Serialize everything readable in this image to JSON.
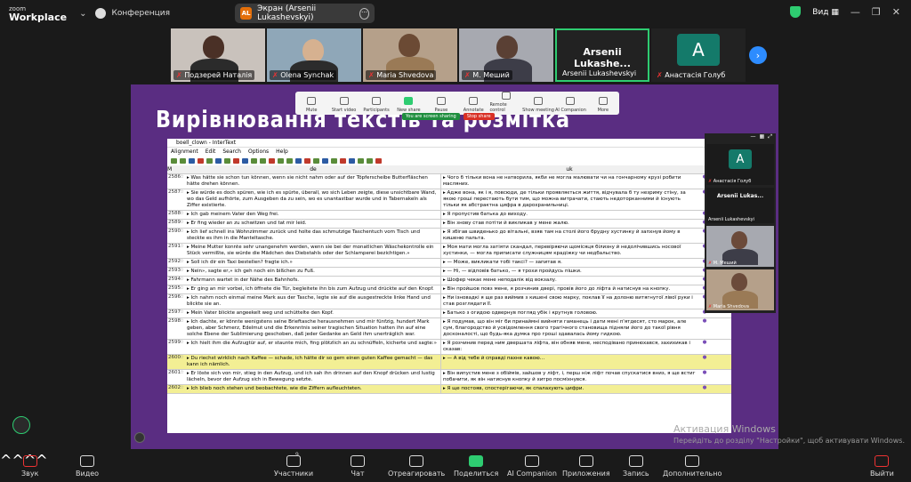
{
  "app": {
    "logo_top": "zoom",
    "logo_bottom": "Workplace",
    "conference_label": "Конференция"
  },
  "screen_share": {
    "badge": "AL",
    "label": "Экран (Arsenii Lukashevskyi)"
  },
  "top_right": {
    "view_label": "Вид"
  },
  "participants": [
    {
      "name": "Подзерей Наталія"
    },
    {
      "name": "Olena Synchak"
    },
    {
      "name": "Maria Shvedova"
    },
    {
      "name": "М. Меший"
    },
    {
      "name": "Arsenii Lukashevskyi",
      "big": "Arsenii Lukashe..."
    },
    {
      "name": "Анастасія Голуб",
      "initial": "A"
    }
  ],
  "share_toolbar": [
    "Mute",
    "Start video",
    "Participants",
    "New share",
    "Pause",
    "Annotate",
    "Remote control",
    "Show meeting",
    "AI Companion",
    "More"
  ],
  "share_status": {
    "sharing": "You are screen sharing",
    "stop": "Stop share"
  },
  "slide_title": "Вирівнювання текстів та розмітка",
  "intertext": {
    "window_title": "boell_clown - InterText",
    "menu": [
      "Alignment",
      "Edit",
      "Search",
      "Options",
      "Help"
    ],
    "columns": [
      "M",
      "de",
      "uk"
    ],
    "rows": [
      {
        "n": "2586",
        "de": "▸ Was hätte sie schon tun können, wenn sie nicht nahm oder auf der Töpferscheibe Butterfläschen hätte drehen können.",
        "uk": "▸ Чого б тільки вона не натворила, якби не могла малювати чи на гончарному крузі робити масляних.",
        "hl": false
      },
      {
        "n": "2587",
        "de": "▸ Sie würde es doch spüren, wie ich es spürte, überall, wo sich Leben zeigte, diese unsichtbare Wand, wo das Geld aufhörte, zum Ausgeben da zu sein, wo es unantastbar wurde und in Tabernakeln als Ziffer existierte.",
        "uk": "▸ Адже вона, як і я, повсюди, де тільки проявляється життя, відчувала б ту незриму стіну, за якою гроші перестають бути тим, що можна витрачати, стають недоторканними й існують тільки як абстрактна цифра в дарохранильниці.",
        "hl": false
      },
      {
        "n": "2588",
        "de": "▸ Ich gab meinem Vater den Weg frei.",
        "uk": "▸ Я пропустив батька до виходу.",
        "hl": false
      },
      {
        "n": "2589",
        "de": "▸ Er fing wieder an zu schwitzen und tat mir leid.",
        "uk": "▸ Він знову став потіти й викликав у мене жалю.",
        "hl": false
      },
      {
        "n": "2590",
        "de": "▸ Ich lief schnell ins Wohnzimmer zurück und holte das schmutzige Taschentuch vom Tisch und steckte es ihm in die Manteltasche.",
        "uk": "▸ Я збігав швиденько до вітальні, взяв там на столі його брудну хустинку й запхнув йому в кишеню пальта.",
        "hl": false
      },
      {
        "n": "2591",
        "de": "▸ Meine Mutter konnte sehr unangenehm werden, wenn sie bei der monatlichen Wäschekontrolle ein Stück vermißte, sie würde die Mädchen des Diebstahls oder der Schlamperei bezichtigen.»",
        "uk": "▸ Моя мати могла затіяти скандал, перевіряючи щомісяця білизну й недолічившись носової хустинки, — могла приписати служницям крадіжку чи недбальство.",
        "hl": false
      },
      {
        "n": "2592",
        "de": "▸ Soll ich dir ein Taxi bestellen? fragte ich.»",
        "uk": "▸ — Може, викликати тобі таксі? — запитав я.",
        "hl": false
      },
      {
        "n": "2593",
        "de": "▸ Nein», sagte er,» ich geh noch ein bißchen zu Fuß.",
        "uk": "▸ — Ні, — відповів батько, — я трохи пройдусь пішки.",
        "hl": false
      },
      {
        "n": "2594",
        "de": "▸ Fahrmann wartet in der Nähe des Bahnhofs.",
        "uk": "▸ Шофер чекає мене неподалік від вокзалу.",
        "hl": false
      },
      {
        "n": "2595",
        "de": "▸ Er ging an mir vorbei, ich öffnete die Tür, begleitete ihn bis zum Aufzug und drückte auf den Knopf.",
        "uk": "▸ Він пройшов повз мене, я розчинив двері, провів його до ліфта й натиснув на кнопку.",
        "hl": false
      },
      {
        "n": "2596",
        "de": "▸ Ich nahm noch einmal meine Mark aus der Tasche, legte sie auf die ausgestreckte linke Hand und blickte sie an.",
        "uk": "▸ Ни ізновадкі я ще раз виймив з кишені свою марку, поклав її на долоню витягнутої лівої руки і став розглядати її.",
        "hl": false
      },
      {
        "n": "2597",
        "de": "▸ Mein Vater blickte angeekelt weg und schüttelte den Kopf.",
        "uk": "▸ Батько з огидою одвернув погляд убік і крутнув головою.",
        "hl": false
      },
      {
        "n": "2598",
        "de": "▸ Ich dachte, er könnte wenigstens seine Brieftasche herausnehmen und mir fünfzig, hundert Mark geben, aber Schmerz, Edelmut und die Erkenntnis seiner tragischen Situation hatten ihn auf eine solche Ebene der Sublimierung geschoben, daß jeder Gedanke an Geld ihm unerträglich war.",
        "uk": "▸ Я подумав, що він міг би принаймні вийняти гаманець і дати мені п'ятдесят, сто марок, але сум, благородство й усвідомлення свого трагічного становища підняли його до такої рівня досконалості, що будь-яка думка про гроші здавалась йому гидкою.",
        "hl": false
      },
      {
        "n": "2599",
        "de": "▸ Ich hielt ihm die Aufzugtür auf, er staunte mich, fing plötzlich an zu schnüffeln, kicherte und sagte:»",
        "uk": "▸ Я розчинив перед ним двершата ліфта, він обняв мене, несподівано принюхався, захихикав і сказав:",
        "hl": false
      },
      {
        "n": "2600",
        "de": "▸ Du riechst wirklich nach Kaffee — schade, ich hätte dir so gern einen guten Kaffee gemacht — das kann ich nämlich.",
        "uk": "▸ — А від тебе й справді пахне кавою…",
        "hl": true
      },
      {
        "n": "2601",
        "de": "▸ Er löste sich von mir, stieg in den Aufzug, und ich sah ihn drinnen auf den Knopf drücken und lustig lächeln, bevor der Aufzug sich in Bewegung setzte.",
        "uk": "▸ Він випустив мене з обіймів, зайшов у ліфт, і, перш ніж ліфт почав спускатися вниз, я ще встиг побачити, як він натиснув кнопку й хитро посміхнувся.",
        "hl": false
      },
      {
        "n": "2602",
        "de": "▸ Ich blieb noch stehen und beobachtete, wie die Ziffern aufleuchteten.",
        "uk": "▸ Я ще постояв, спостерігаючи, як спалахують цифри.",
        "hl": true
      }
    ]
  },
  "side_panel": [
    {
      "name": "Анастасія Голуб",
      "initial": "A"
    },
    {
      "name": "Arsenii Lukashevskyi",
      "big": "Arsenii Lukas..."
    },
    {
      "name": "М. Меший"
    },
    {
      "name": "Maria Shvedova"
    }
  ],
  "watermark": {
    "line1": "Активация Windows",
    "line2": "Перейдіть до розділу \"Настройки\", щоб активувати Windows."
  },
  "bottom_bar": {
    "audio": "Звук",
    "video": "Видео",
    "participants": "Участники",
    "participants_count": "9",
    "chat": "Чат",
    "react": "Отреагировать",
    "share": "Поделиться",
    "ai": "AI Companion",
    "apps": "Приложения",
    "record": "Запись",
    "more": "Дополнительно",
    "leave": "Выйти"
  }
}
